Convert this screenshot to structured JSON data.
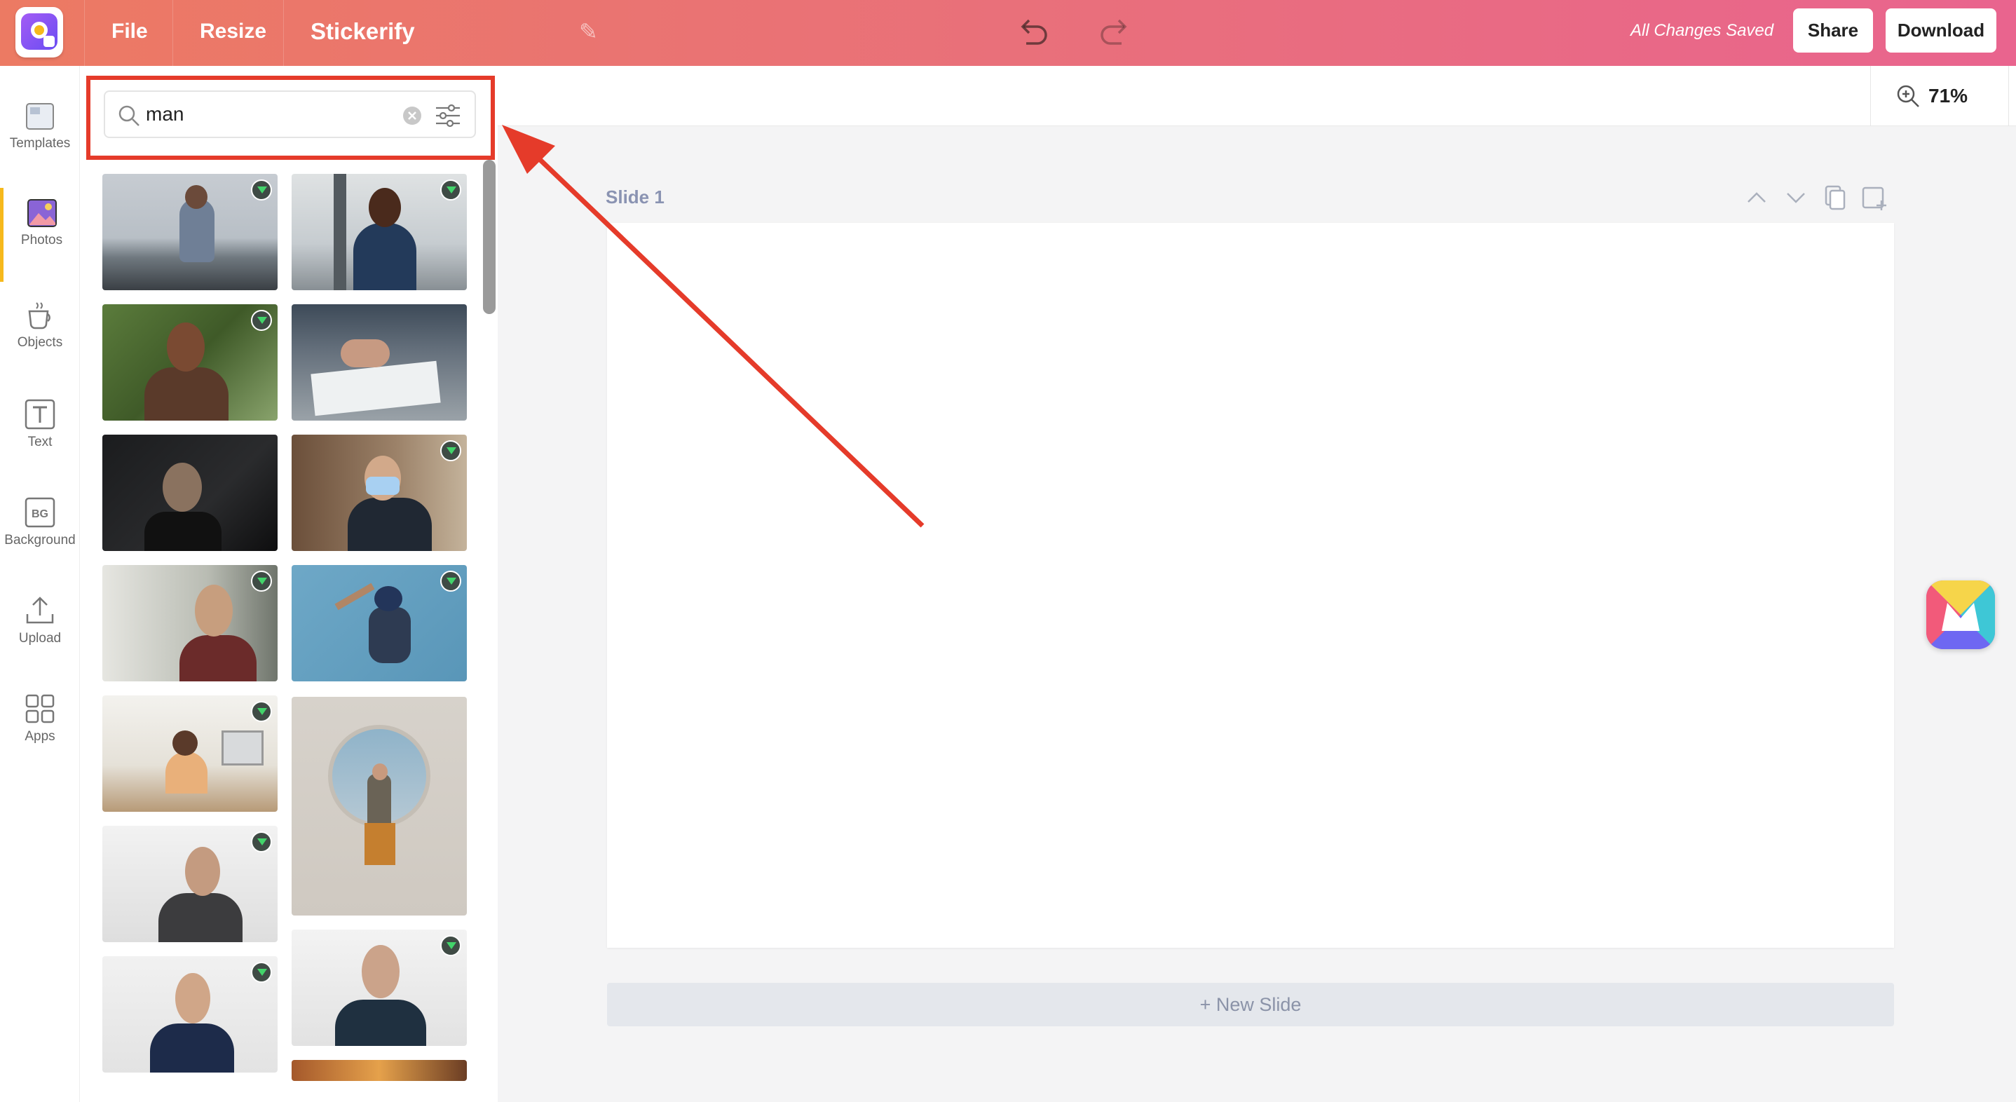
{
  "topbar": {
    "menu": [
      "File",
      "Resize"
    ],
    "title": "Stickerify",
    "status": "All Changes Saved",
    "share_label": "Share",
    "download_label": "Download"
  },
  "sidebar": {
    "items": [
      {
        "label": "Templates",
        "icon": "templates-icon"
      },
      {
        "label": "Photos",
        "icon": "photos-icon",
        "active": true
      },
      {
        "label": "Objects",
        "icon": "objects-icon"
      },
      {
        "label": "Text",
        "icon": "text-icon"
      },
      {
        "label": "Background",
        "icon": "background-icon",
        "badge": "BG"
      },
      {
        "label": "Upload",
        "icon": "upload-icon"
      },
      {
        "label": "Apps",
        "icon": "apps-icon"
      }
    ]
  },
  "search": {
    "value": "man"
  },
  "photos": [
    {
      "desc": "man-leaning-railing",
      "premium": true
    },
    {
      "desc": "smiling-man-office",
      "premium": true
    },
    {
      "desc": "older-man-portrait",
      "premium": true
    },
    {
      "desc": "hand-signing-document",
      "premium": false
    },
    {
      "desc": "man-dark-suit",
      "premium": false
    },
    {
      "desc": "man-with-mask-vaccinated",
      "premium": true
    },
    {
      "desc": "man-profile-red-sweater",
      "premium": true
    },
    {
      "desc": "man-dancing-blue-wall",
      "premium": true
    },
    {
      "desc": "man-at-desk",
      "premium": true
    },
    {
      "desc": "man-sitting-round-window",
      "premium": false
    },
    {
      "desc": "bearded-man-gray-cardigan",
      "premium": true
    },
    {
      "desc": "man-glasses-arms-crossed",
      "premium": true
    },
    {
      "desc": "curly-hair-man-sweater",
      "premium": true
    },
    {
      "desc": "sunset-partial",
      "premium": false
    }
  ],
  "zoom": {
    "value": "71%"
  },
  "slide": {
    "label": "Slide 1",
    "new_slide_label": "+ New Slide"
  },
  "colors": {
    "topbar_start": "#ec7a63",
    "topbar_end": "#e9648e",
    "highlight": "#e53b2a",
    "accent": "#f6b91c"
  }
}
